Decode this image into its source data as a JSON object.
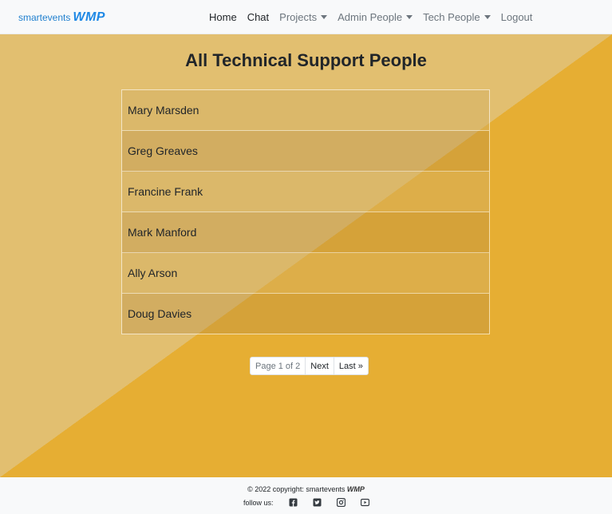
{
  "brand": {
    "small": "smartevents",
    "logo": "WMP"
  },
  "nav": [
    {
      "label": "Home",
      "active": true,
      "dropdown": false
    },
    {
      "label": "Chat",
      "active": true,
      "dropdown": false
    },
    {
      "label": "Projects",
      "active": false,
      "dropdown": true
    },
    {
      "label": "Admin People",
      "active": false,
      "dropdown": true
    },
    {
      "label": "Tech People",
      "active": false,
      "dropdown": true
    },
    {
      "label": "Logout",
      "active": false,
      "dropdown": false
    }
  ],
  "page": {
    "title": "All Technical Support People"
  },
  "people": [
    "Mary Marsden",
    "Greg Greaves",
    "Francine Frank",
    "Mark Manford",
    "Ally Arson",
    "Doug Davies"
  ],
  "pager": {
    "info": "Page 1 of 2",
    "next": "Next",
    "last": "Last »"
  },
  "footer": {
    "copyright": "© 2022 copyright: smartevents",
    "logo": "WMP",
    "follow": "follow us:",
    "social": [
      "facebook-icon",
      "twitter-icon",
      "instagram-icon",
      "youtube-icon"
    ]
  },
  "colors": {
    "accent": "#1e88e5",
    "background": "#e2bf70",
    "diagonal": "#e6ae33"
  }
}
